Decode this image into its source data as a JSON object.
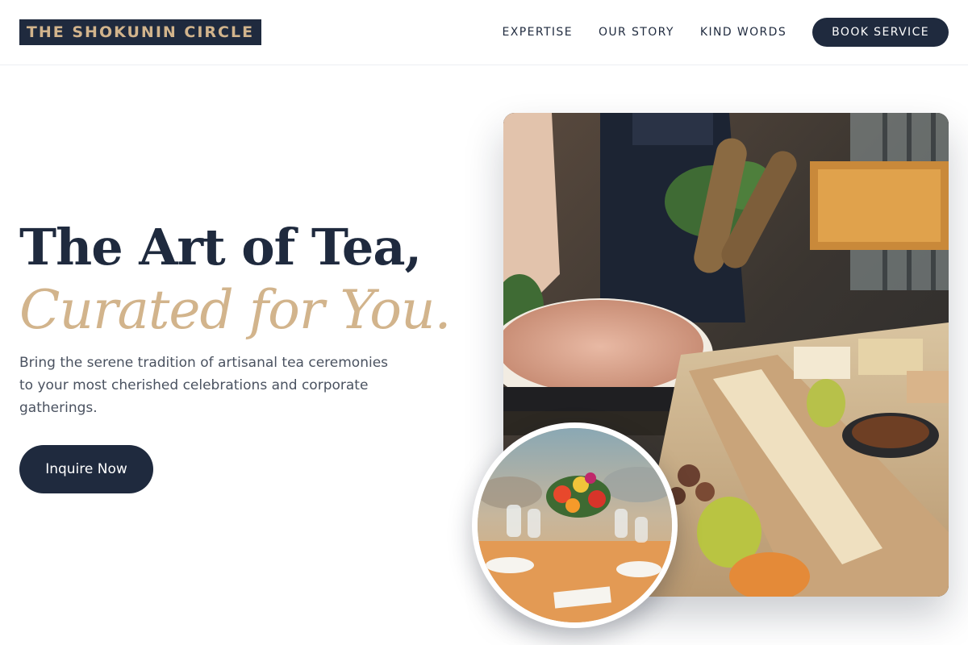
{
  "brand": {
    "logo_text": "THE SHOKUNIN CIRCLE",
    "colors": {
      "navy": "#1f2a3e",
      "gold": "#d2b48c",
      "body_text": "#4a5260",
      "background": "#ffffff"
    }
  },
  "nav": {
    "links": [
      {
        "label": "EXPERTISE"
      },
      {
        "label": "OUR STORY"
      },
      {
        "label": "KIND WORDS"
      }
    ],
    "cta_label": "BOOK SERVICE"
  },
  "hero": {
    "title_line1": "The Art of Tea,",
    "title_line2": "Curated for You.",
    "description": "Bring the serene tradition of artisanal tea ceremonies to your most cherished celebrations and corporate gatherings.",
    "cta_label": "Inquire Now",
    "main_image": {
      "icon": "catering-spread-photo"
    },
    "inset_image": {
      "icon": "table-setting-flowers-photo"
    }
  }
}
